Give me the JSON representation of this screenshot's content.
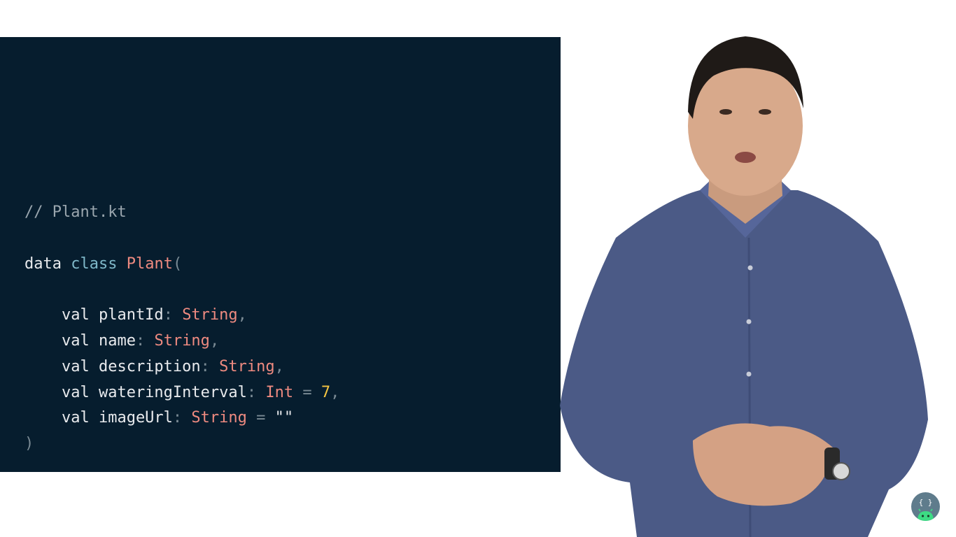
{
  "code": {
    "lines": [
      [
        {
          "t": "// Plant.kt",
          "c": "comment"
        }
      ],
      [
        {
          "t": "data ",
          "c": "plain"
        },
        {
          "t": "class ",
          "c": "kw"
        },
        {
          "t": "Plant",
          "c": "class"
        },
        {
          "t": "(",
          "c": "punct"
        }
      ],
      [
        {
          "t": "    val plantId",
          "c": "plain"
        },
        {
          "t": ": ",
          "c": "punct"
        },
        {
          "t": "String",
          "c": "type"
        },
        {
          "t": ",",
          "c": "punct"
        }
      ],
      [
        {
          "t": "    val name",
          "c": "plain"
        },
        {
          "t": ": ",
          "c": "punct"
        },
        {
          "t": "String",
          "c": "type"
        },
        {
          "t": ",",
          "c": "punct"
        }
      ],
      [
        {
          "t": "    val description",
          "c": "plain"
        },
        {
          "t": ": ",
          "c": "punct"
        },
        {
          "t": "String",
          "c": "type"
        },
        {
          "t": ",",
          "c": "punct"
        }
      ],
      [
        {
          "t": "    val wateringInterval",
          "c": "plain"
        },
        {
          "t": ": ",
          "c": "punct"
        },
        {
          "t": "Int",
          "c": "type"
        },
        {
          "t": " = ",
          "c": "punct"
        },
        {
          "t": "7",
          "c": "num"
        },
        {
          "t": ",",
          "c": "punct"
        }
      ],
      [
        {
          "t": "    val imageUrl",
          "c": "plain"
        },
        {
          "t": ": ",
          "c": "punct"
        },
        {
          "t": "String",
          "c": "type"
        },
        {
          "t": " = ",
          "c": "punct"
        },
        {
          "t": "\"\"",
          "c": "plain"
        }
      ],
      [
        {
          "t": ")",
          "c": "punct"
        }
      ]
    ]
  },
  "colors": {
    "panel_bg": "#061d2e",
    "comment": "#9aa6ae",
    "keyword": "#7fb8c9",
    "type": "#ee8a80",
    "number": "#f5c542",
    "shirt": "#4b5a86"
  },
  "badge": {
    "icon": "android-braces-icon",
    "text": "{ }"
  }
}
